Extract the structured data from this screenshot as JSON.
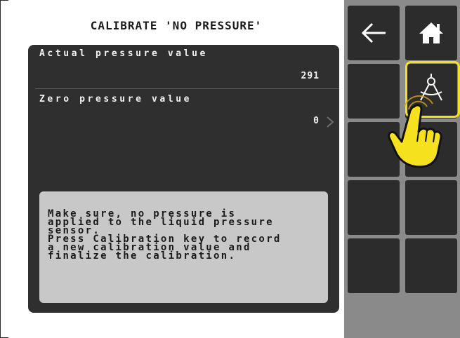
{
  "screen": {
    "title": "CALIBRATE 'NO PRESSURE'"
  },
  "values": {
    "actual_pressure_label": "Actual pressure value",
    "actual_pressure_value": "291",
    "zero_pressure_label": "Zero pressure value",
    "zero_pressure_value": "0"
  },
  "info": {
    "text": "Make sure, no pressure is\napplied to the liquid pressure\nsensor.\nPress Calibration key to record\na new calibration value and\nfinalize the calibration."
  },
  "softkeys": [
    {
      "name": "back",
      "icon": "arrow-left-icon"
    },
    {
      "name": "home",
      "icon": "home-icon"
    },
    {
      "name": "empty",
      "icon": ""
    },
    {
      "name": "calibration",
      "icon": "compass-icon",
      "highlighted": true
    },
    {
      "name": "empty",
      "icon": ""
    },
    {
      "name": "empty",
      "icon": ""
    },
    {
      "name": "empty",
      "icon": ""
    },
    {
      "name": "empty",
      "icon": ""
    },
    {
      "name": "empty",
      "icon": ""
    },
    {
      "name": "empty",
      "icon": ""
    }
  ],
  "colors": {
    "panel": "#2f2f2f",
    "info_box": "#c8c8c8",
    "softkey_bar": "#8a8a8a",
    "softkey": "#2c2c2c",
    "highlight": "#f5e11a"
  }
}
